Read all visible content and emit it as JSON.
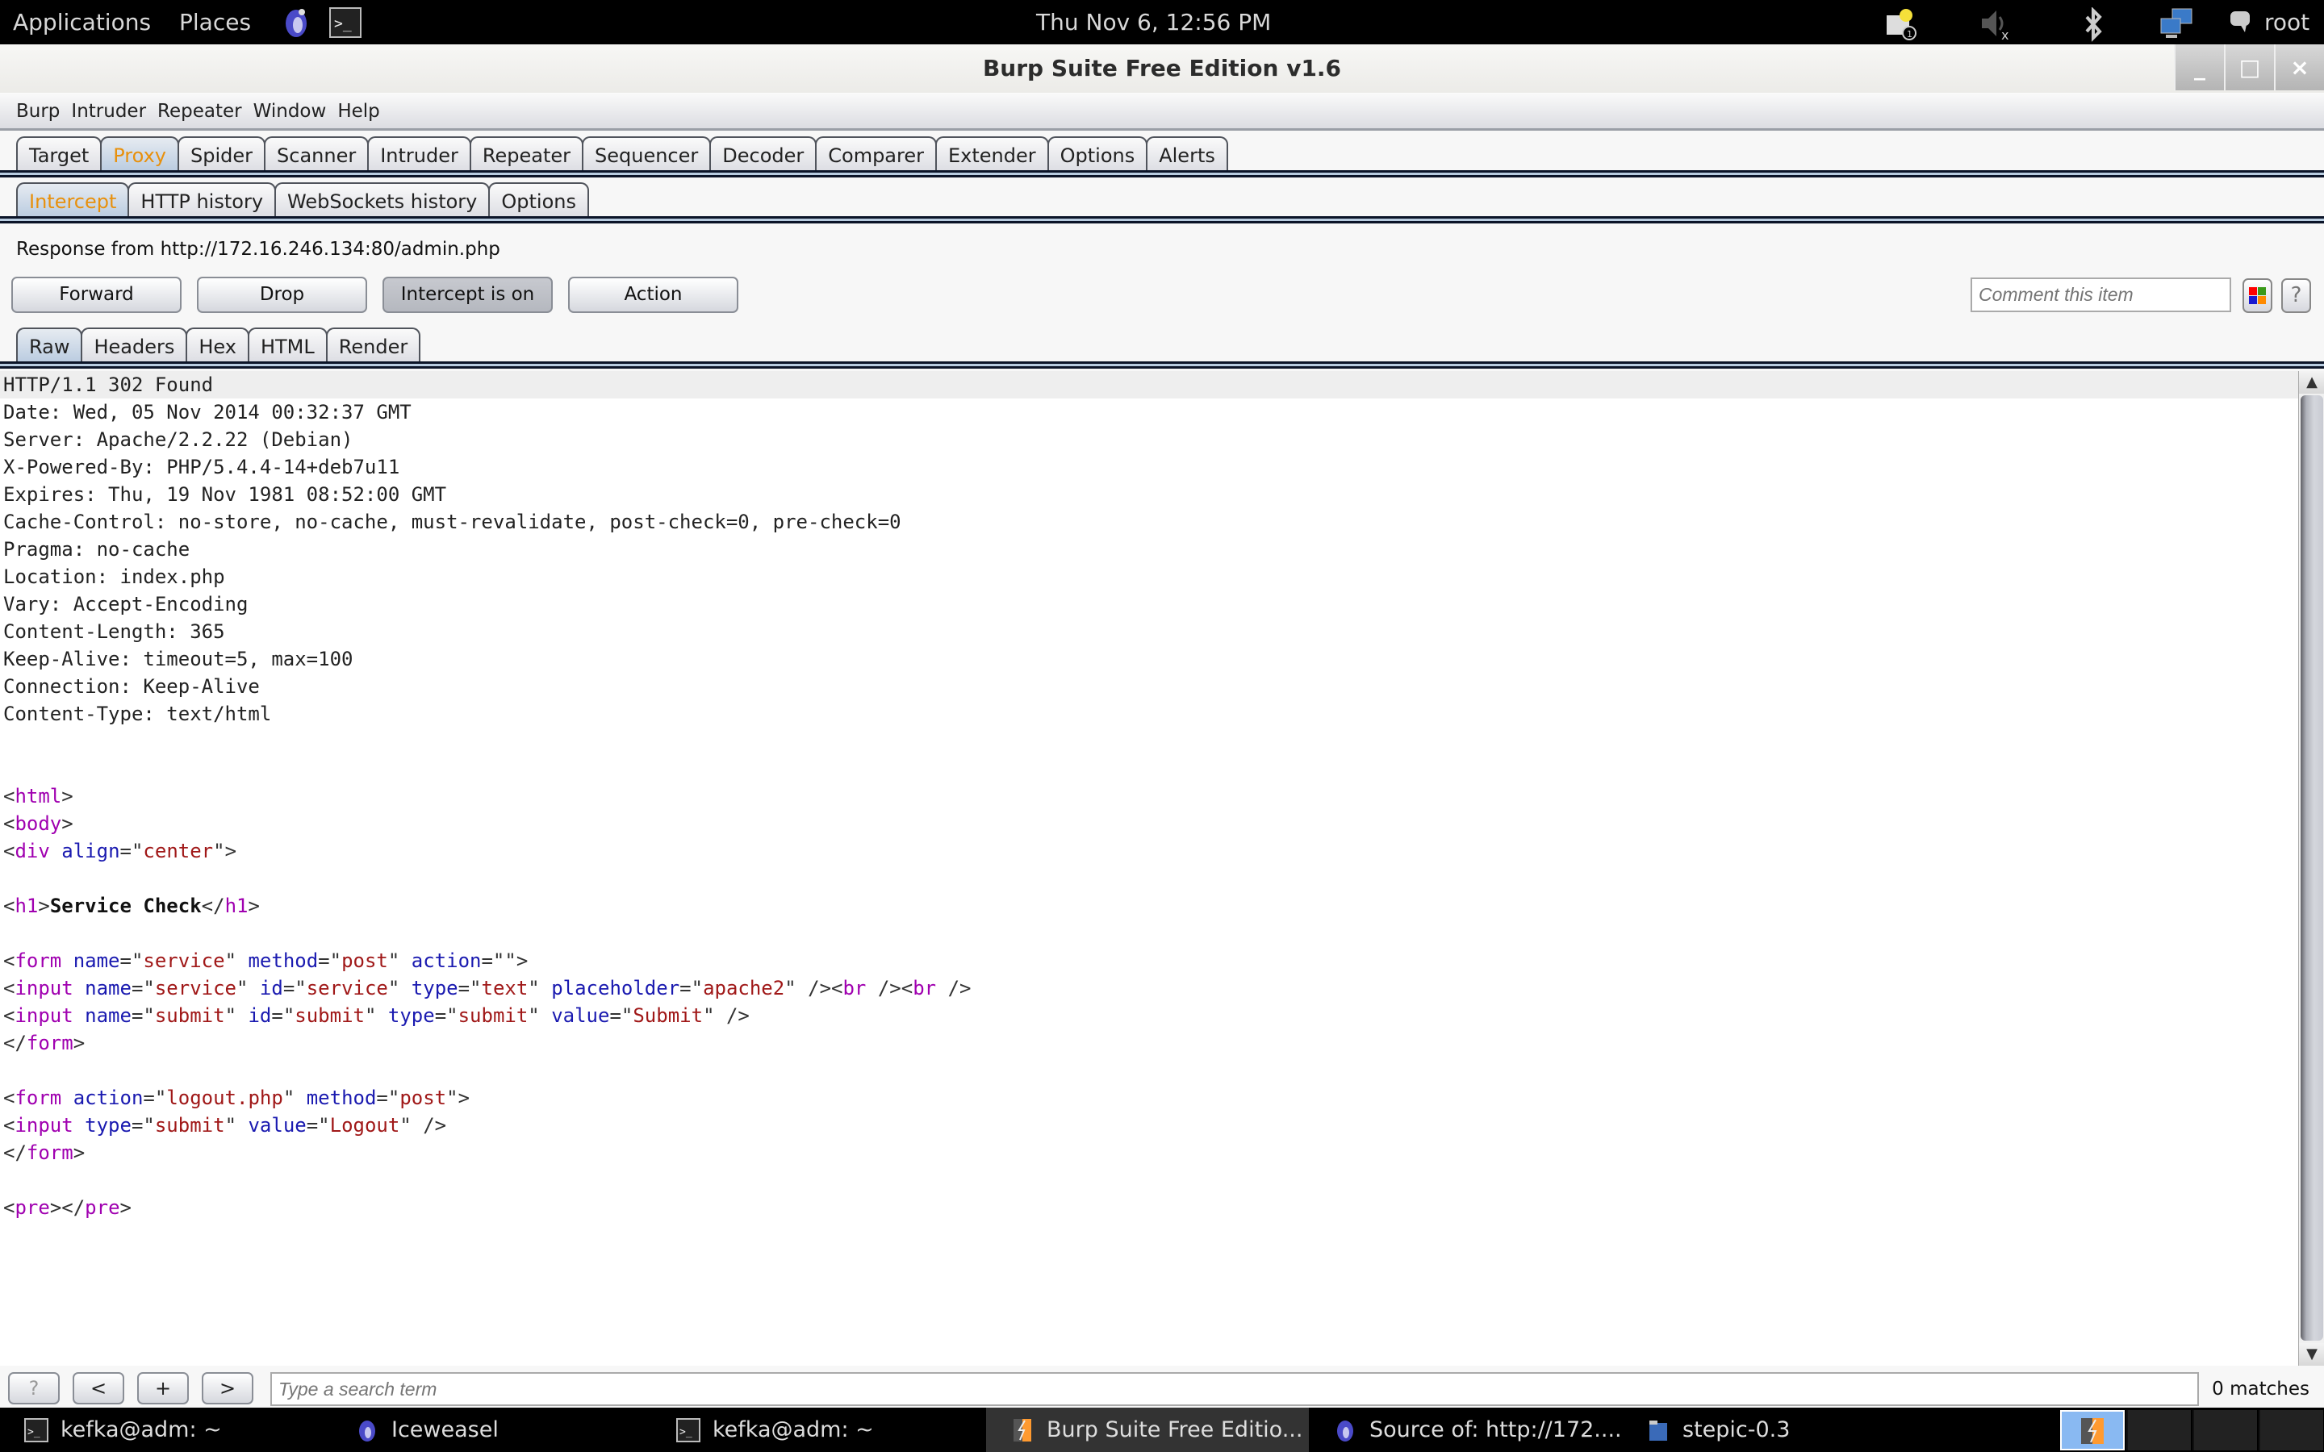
{
  "top_panel": {
    "applications": "Applications",
    "places": "Places",
    "clock": "Thu Nov  6, 12:56 PM",
    "user": "root",
    "notification_count": "1"
  },
  "window": {
    "title": "Burp Suite Free Edition v1.6",
    "minimize": "_",
    "maximize": "□",
    "close": "×"
  },
  "menubar": [
    "Burp",
    "Intruder",
    "Repeater",
    "Window",
    "Help"
  ],
  "main_tabs": [
    "Target",
    "Proxy",
    "Spider",
    "Scanner",
    "Intruder",
    "Repeater",
    "Sequencer",
    "Decoder",
    "Comparer",
    "Extender",
    "Options",
    "Alerts"
  ],
  "main_tab_active": "Proxy",
  "proxy_tabs": [
    "Intercept",
    "HTTP history",
    "WebSockets history",
    "Options"
  ],
  "proxy_tab_active": "Intercept",
  "intercept": {
    "response_label": "Response from http://172.16.246.134:80/admin.php",
    "buttons": {
      "forward": "Forward",
      "drop": "Drop",
      "intercept_toggle": "Intercept is on",
      "action": "Action"
    },
    "comment_placeholder": "Comment this item",
    "help": "?"
  },
  "view_tabs": [
    "Raw",
    "Headers",
    "Hex",
    "HTML",
    "Render"
  ],
  "view_tab_active": "Raw",
  "response": {
    "headers": [
      "HTTP/1.1 302 Found",
      "Date: Wed, 05 Nov 2014 00:32:37 GMT",
      "Server: Apache/2.2.22 (Debian)",
      "X-Powered-By: PHP/5.4.4-14+deb7u11",
      "Expires: Thu, 19 Nov 1981 08:52:00 GMT",
      "Cache-Control: no-store, no-cache, must-revalidate, post-check=0, pre-check=0",
      "Pragma: no-cache",
      "Location: index.php",
      "Vary: Accept-Encoding",
      "Content-Length: 365",
      "Keep-Alive: timeout=5, max=100",
      "Connection: Keep-Alive",
      "Content-Type: text/html"
    ],
    "body_lines": [
      "",
      "",
      "<html>",
      "<body>",
      "<div align=\"center\">",
      "",
      "<h1>Service Check</h1>",
      "",
      "<form name=\"service\" method=\"post\" action=\"\">",
      "<input name=\"service\" id=\"service\" type=\"text\" placeholder=\"apache2\" /><br /><br />",
      "<input name=\"submit\" id=\"submit\" type=\"submit\" value=\"Submit\" />",
      "</form>",
      "",
      "<form action=\"logout.php\" method=\"post\">",
      "<input type=\"submit\" value=\"Logout\" />",
      "</form>",
      "",
      "<pre></pre>"
    ]
  },
  "search": {
    "help": "?",
    "prev": "<",
    "add": "+",
    "next": ">",
    "placeholder": "Type a search term",
    "matches": "0 matches"
  },
  "taskbar": [
    {
      "label": "kefka@adm: ~",
      "icon": "terminal-icon"
    },
    {
      "label": "Iceweasel",
      "icon": "iceweasel-icon"
    },
    {
      "label": "kefka@adm: ~",
      "icon": "terminal-icon"
    },
    {
      "label": "Burp Suite Free Editio...",
      "icon": "burp-icon",
      "active": true
    },
    {
      "label": "Source of: http://172....",
      "icon": "iceweasel-icon"
    },
    {
      "label": "stepic-0.3",
      "icon": "folder-icon"
    }
  ],
  "colors": {
    "active_tab_text": "#e8900c",
    "tag": "#a000b0",
    "attribute": "#1a1ab0",
    "value": "#a01818"
  }
}
